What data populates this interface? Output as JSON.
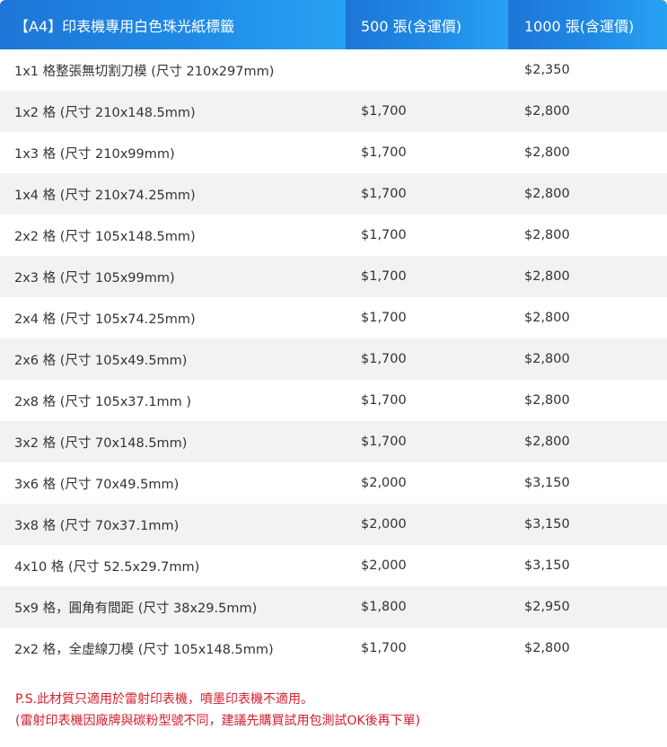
{
  "header": {
    "col1": "【A4】印表機專用白色珠光紙標籤",
    "col2": "500 張(含運價)",
    "col3": "1000  張(含運價)"
  },
  "rows": [
    {
      "name": "1x1   格整張無切割刀模 (尺寸 210x297mm)",
      "p500": "",
      "p1000": "$2,350"
    },
    {
      "name": "1x2  格 (尺寸 210x148.5mm)",
      "p500": "$1,700",
      "p1000": "$2,800"
    },
    {
      "name": "1x3  格 (尺寸 210x99mm)",
      "p500": "$1,700",
      "p1000": "$2,800"
    },
    {
      "name": "1x4  格 (尺寸 210x74.25mm)",
      "p500": "$1,700",
      "p1000": "$2,800"
    },
    {
      "name": "2x2 格 (尺寸 105x148.5mm)",
      "p500": "$1,700",
      "p1000": "$2,800"
    },
    {
      "name": "2x3 格 (尺寸 105x99mm)",
      "p500": "$1,700",
      "p1000": "$2,800"
    },
    {
      "name": "2x4 格 (尺寸 105x74.25mm)",
      "p500": "$1,700",
      "p1000": "$2,800"
    },
    {
      "name": "2x6 格 (尺寸 105x49.5mm)",
      "p500": "$1,700",
      "p1000": "$2,800"
    },
    {
      "name": "2x8 格 (尺寸 105x37.1mm )",
      "p500": "$1,700",
      "p1000": "$2,800"
    },
    {
      "name": "3x2 格 (尺寸 70x148.5mm)",
      "p500": "$1,700",
      "p1000": "$2,800"
    },
    {
      "name": "3x6 格 (尺寸 70x49.5mm)",
      "p500": "$2,000",
      "p1000": "$3,150"
    },
    {
      "name": "3x8 格 (尺寸 70x37.1mm)",
      "p500": "$2,000",
      "p1000": "$3,150"
    },
    {
      "name": "4x10  格 (尺寸 52.5x29.7mm)",
      "p500": "$2,000",
      "p1000": "$3,150"
    },
    {
      "name": "5x9 格，圓角有間距 (尺寸 38x29.5mm)",
      "p500": "$1,800",
      "p1000": "$2,950"
    },
    {
      "name": "2x2 格，全虛線刀模 (尺寸 105x148.5mm)",
      "p500": "$1,700",
      "p1000": "$2,800"
    }
  ],
  "notes": {
    "line1": "P.S.此材質只適用於雷射印表機，噴墨印表機不適用。",
    "line2": "(雷射印表機因廠牌與碳粉型號不同，建議先購買試用包測試OK後再下單)"
  },
  "colors": {
    "header_start": "#1e76d7",
    "header_end": "#27a3f3",
    "note_red": "#d11f2e",
    "row_alt": "#f2f2f2"
  }
}
